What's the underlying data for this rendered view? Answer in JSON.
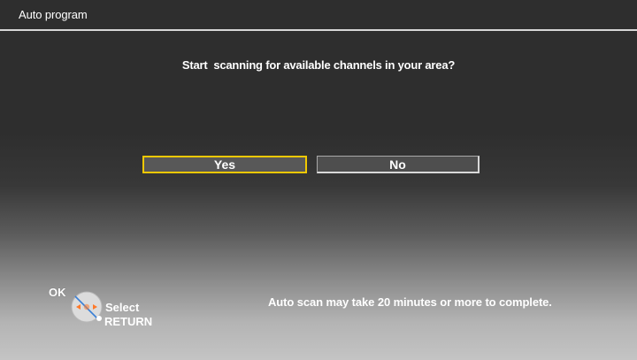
{
  "header": {
    "title": "Auto program"
  },
  "dialog": {
    "question": "Start  scanning for available channels in your area?",
    "buttons": {
      "yes_label": "Yes",
      "no_label": "No"
    }
  },
  "hints": {
    "ok_label": "OK",
    "select_label": "Select",
    "return_label": "RETURN",
    "ok_icon": "remote-dpad-icon",
    "return_icon": "return-dot-icon"
  },
  "note": "Auto scan may take 20 minutes or more to complete.",
  "colors": {
    "focus_border": "#f0c800",
    "dpad_arrow": "#ff7a2a"
  }
}
